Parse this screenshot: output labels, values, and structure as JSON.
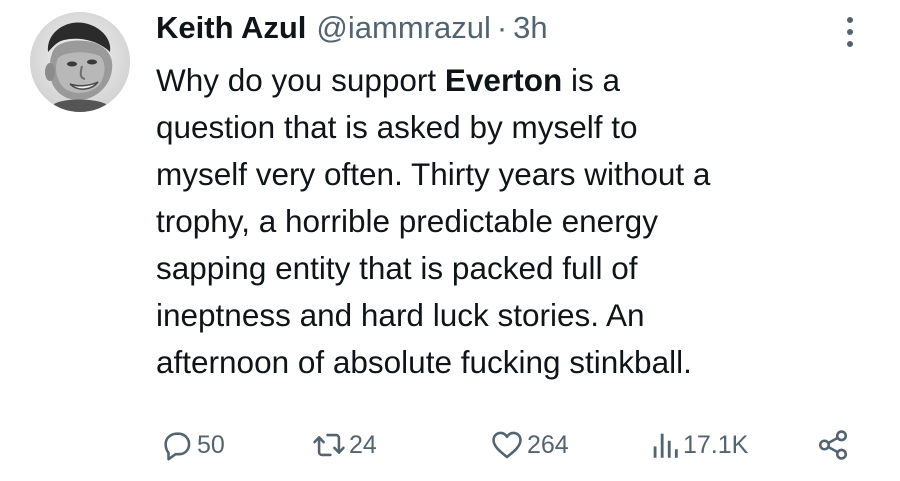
{
  "tweet": {
    "author_name": "Keith Azul",
    "handle": "@iammrazul",
    "separator": "·",
    "time": "3h",
    "text_lines": [
      {
        "pre": "Why do you support ",
        "bold": "Everton",
        "post": " is a"
      },
      {
        "pre": "question that is asked by myself to"
      },
      {
        "pre": "myself very often. Thirty years without a"
      },
      {
        "pre": "trophy, a horrible predictable energy"
      },
      {
        "pre": "sapping entity that is packed full of"
      },
      {
        "pre": "ineptness and hard luck stories. An"
      },
      {
        "pre": "afternoon of absolute fucking stinkball."
      }
    ],
    "stats": {
      "replies": "50",
      "retweets": "24",
      "likes": "264",
      "views": "17.1K"
    }
  },
  "icons": {
    "reply": "reply-icon",
    "retweet": "retweet-icon",
    "like": "heart-icon",
    "views": "views-icon",
    "share": "share-icon",
    "more": "more-icon"
  },
  "colors": {
    "text": "#0f1419",
    "secondary": "#536471",
    "background": "#ffffff"
  }
}
